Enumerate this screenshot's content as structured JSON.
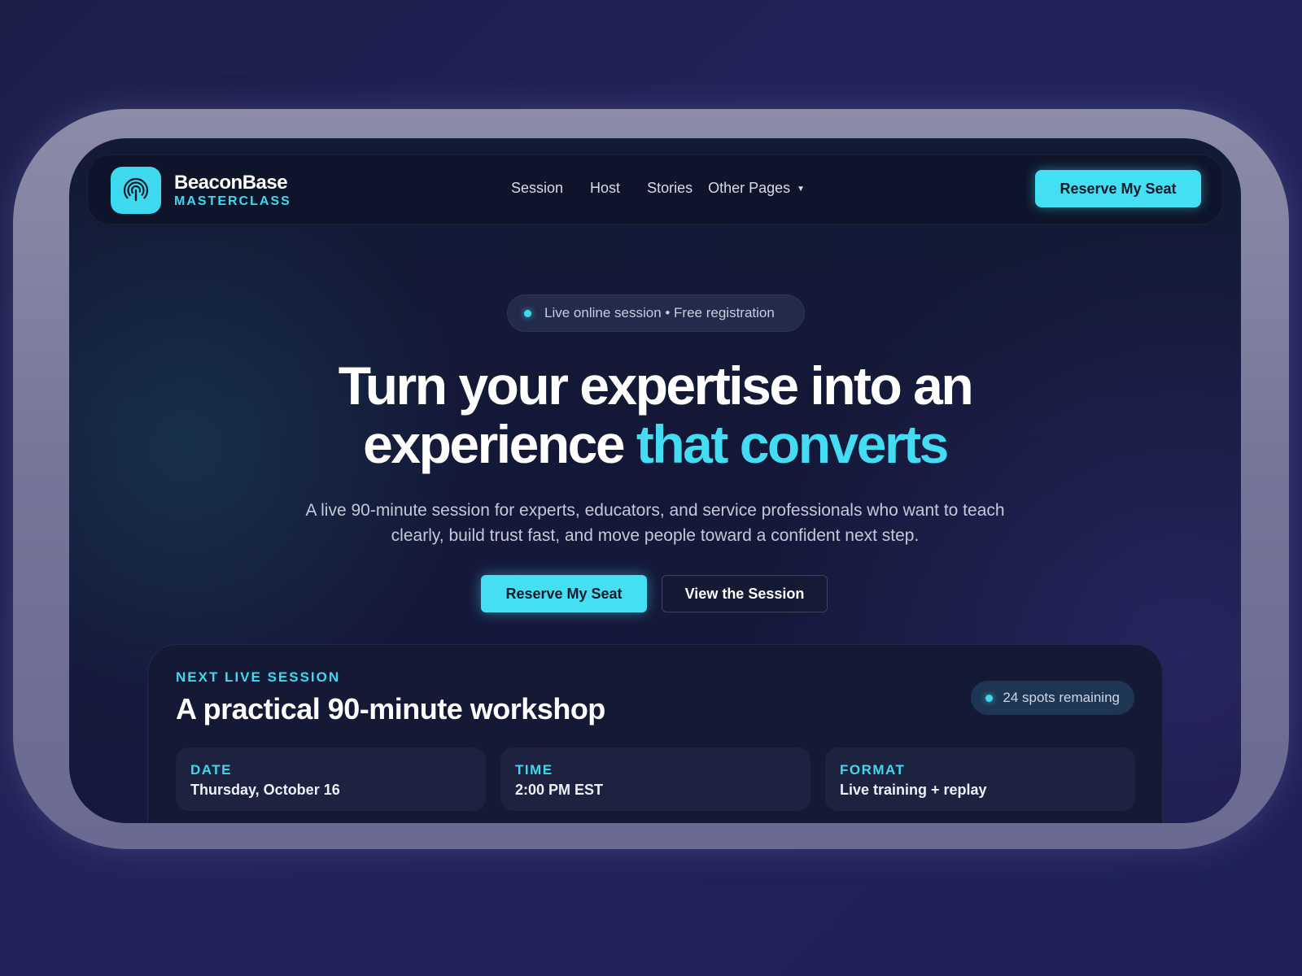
{
  "brand": {
    "name": "BeaconBase",
    "subtitle": "MASTERCLASS",
    "icon": "broadcast-signal-icon"
  },
  "nav": {
    "links": [
      "Session",
      "Host",
      "Stories",
      "Other Pages"
    ],
    "cta_label": "Reserve My Seat"
  },
  "hero": {
    "pill_text": "Live online session • Free registration",
    "headline_line1": "Turn your expertise into an",
    "headline_line2_plain": "experience",
    "headline_line2_accent": "that converts",
    "subtext": "A live 90-minute session for experts, educators, and service professionals who want to teach clearly, build trust fast, and move people toward a confident next step.",
    "primary_button": "Reserve My Seat",
    "secondary_button": "View the Session"
  },
  "session_card": {
    "kicker": "NEXT LIVE SESSION",
    "title": "A practical 90-minute workshop",
    "spots_badge": "24 spots remaining",
    "details": [
      {
        "label": "DATE",
        "value": "Thursday, October 16"
      },
      {
        "label": "TIME",
        "value": "2:00 PM EST"
      },
      {
        "label": "FORMAT",
        "value": "Live training + replay"
      }
    ]
  },
  "colors": {
    "accent": "#45dff4",
    "background": "#141838",
    "card": "#141a36"
  }
}
